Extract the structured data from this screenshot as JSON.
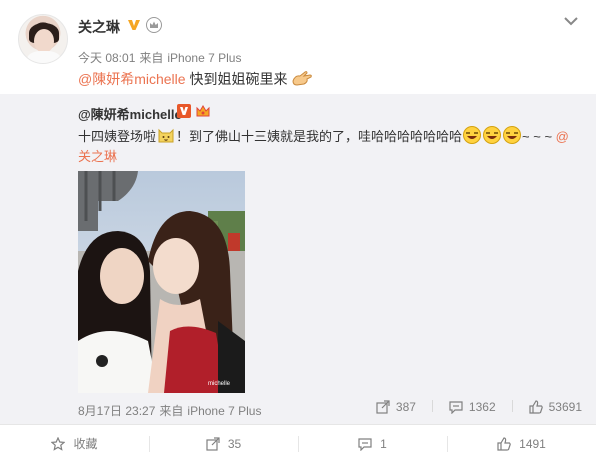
{
  "post": {
    "author": "关之琳",
    "time": "今天 08:01",
    "source_prefix": "来自",
    "source": "iPhone 7 Plus",
    "mention": "@陳妍希michelle",
    "text": " 快到姐姐碗里来",
    "verified_icon": "yellow-v-verified",
    "vip_icon": "crown-vip",
    "menu_icon": "chevron-down"
  },
  "repost": {
    "author": "@陳妍希michelle",
    "text_part1": "十四姨登场啦",
    "text_part2": "！到了佛山十三姨就是我的了，哇哈哈哈哈哈哈哈",
    "text_tail": "~ ~ ~ ",
    "text_mention": "@关之琳",
    "time": "8月17日 23:27",
    "source_prefix": "来自",
    "source": "iPhone 7 Plus",
    "reposts": "387",
    "comments": "1362",
    "likes": "53691",
    "photo_watermark": "michelle"
  },
  "actions": {
    "favorite_label": "收藏",
    "repost_count": "35",
    "comment_count": "1",
    "like_count": "1491"
  },
  "colors": {
    "mention": "#eb7350",
    "muted": "#808080",
    "repost_bg": "#f2f2f5"
  }
}
